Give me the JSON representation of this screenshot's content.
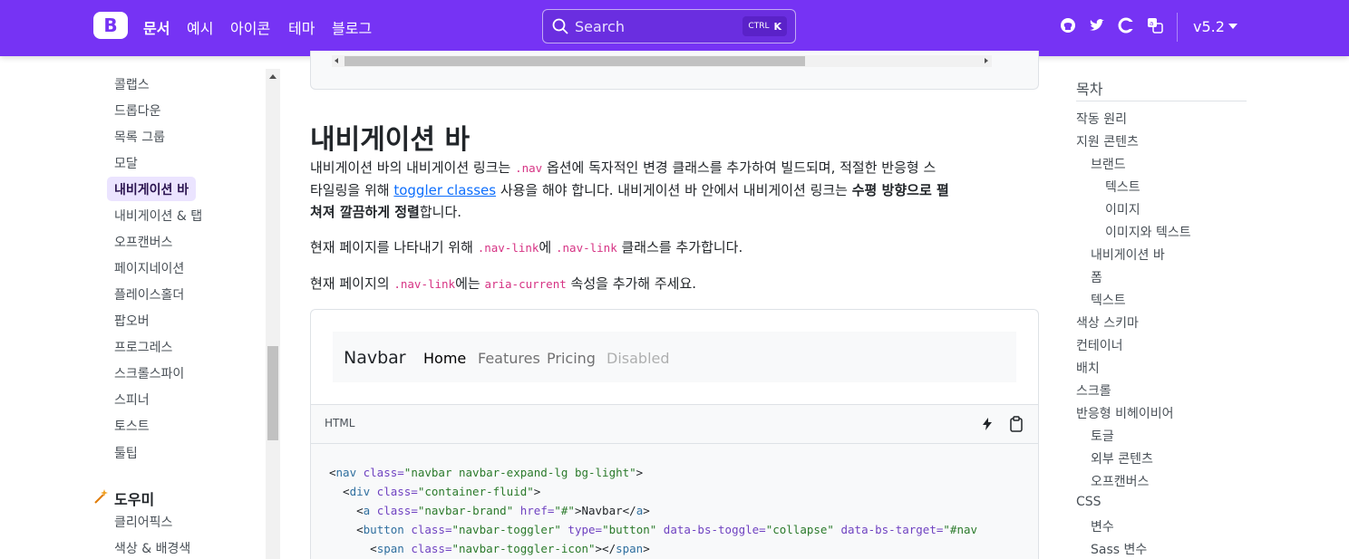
{
  "header": {
    "logo": "B",
    "nav": [
      "문서",
      "예시",
      "아이콘",
      "테마",
      "블로그"
    ],
    "search": {
      "placeholder": "Search",
      "kbd_ctrl": "CTRL",
      "kbd_key": "K"
    },
    "version": "v5.2",
    "icons": [
      "github-icon",
      "twitter-icon",
      "opencollective-icon",
      "translate-icon"
    ],
    "accent": "#7633f4"
  },
  "sidebar": {
    "items": [
      "콜랩스",
      "드롭다운",
      "목록 그룹",
      "모달",
      "내비게이션 바",
      "내비게이션 & 탭",
      "오프캔버스",
      "페이지네이션",
      "플레이스홀더",
      "팝오버",
      "프로그레스",
      "스크롤스파이",
      "스피너",
      "토스트",
      "툴팁"
    ],
    "active": "내비게이션 바",
    "section": "도우미",
    "section_items": [
      "클리어픽스",
      "색상 & 배경색"
    ]
  },
  "main": {
    "partial_top": "&nbsp;",
    "heading": "내비게이션 바",
    "p1": {
      "a": "내비게이션 바의 내비게이션 링크는 ",
      "code1": ".nav",
      "b": " 옵션에 독자적인 변경 클래스를 추가하여 빌드되며, 적절한 반응형 스",
      "c": "타일링을 위해 ",
      "link": "toggler classes",
      "d": " 사용을 해야 합니다. 내비게이션 바 안에서 내비게이션 링크는 ",
      "strong": "수평 방향으로 펼",
      "e": "쳐져 깔끔하게 정렬",
      "f": "합니다."
    },
    "p2": {
      "a": "현재 페이지를 나타내기 위해 ",
      "code1": ".nav-link",
      "b": "에 ",
      "code2": ".nav-link",
      "c": " 클래스를 추가합니다."
    },
    "p3": {
      "a": "현재 페이지의 ",
      "code1": ".nav-link",
      "b": "에는 ",
      "code2": "aria-current",
      "c": " 속성을 추가해 주세요."
    },
    "demo": {
      "brand": "Navbar",
      "links": [
        "Home",
        "Features",
        "Pricing",
        "Disabled"
      ]
    },
    "code_label": "HTML",
    "code_lines": [
      [
        "<",
        "nav",
        " class=",
        "\"navbar navbar-expand-lg bg-light\"",
        ">"
      ],
      [
        "  <",
        "div",
        " class=",
        "\"container-fluid\"",
        ">"
      ],
      [
        "    <",
        "a",
        " class=",
        "\"navbar-brand\"",
        " href=",
        "\"#\"",
        ">Navbar</",
        "a",
        ">"
      ],
      [
        "    <",
        "button",
        " class=",
        "\"navbar-toggler\"",
        " type=",
        "\"button\"",
        " data-bs-toggle=",
        "\"collapse\"",
        " data-bs-target=",
        "\"#nav"
      ],
      [
        "      <",
        "span",
        " class=",
        "\"navbar-toggler-icon\"",
        "></",
        "span",
        ">"
      ]
    ]
  },
  "toc": {
    "title": "목차",
    "items": [
      {
        "t": "작동 원리",
        "lvl": 0
      },
      {
        "t": "지원 콘텐츠",
        "lvl": 0
      },
      {
        "t": "브랜드",
        "lvl": 1
      },
      {
        "t": "텍스트",
        "lvl": 2
      },
      {
        "t": "이미지",
        "lvl": 2
      },
      {
        "t": "이미지와 텍스트",
        "lvl": 2
      },
      {
        "t": "내비게이션 바",
        "lvl": 1
      },
      {
        "t": "폼",
        "lvl": 1
      },
      {
        "t": "텍스트",
        "lvl": 1
      },
      {
        "t": "색상 스키마",
        "lvl": 0
      },
      {
        "t": "컨테이너",
        "lvl": 0
      },
      {
        "t": "배치",
        "lvl": 0
      },
      {
        "t": "스크롤",
        "lvl": 0
      },
      {
        "t": "반응형 비헤이비어",
        "lvl": 0
      },
      {
        "t": "토글",
        "lvl": 1
      },
      {
        "t": "외부 콘텐츠",
        "lvl": 1
      },
      {
        "t": "오프캔버스",
        "lvl": 1
      },
      {
        "t": "CSS",
        "lvl": 0
      },
      {
        "t": "변수",
        "lvl": 1
      },
      {
        "t": "Sass 변수",
        "lvl": 1
      }
    ]
  }
}
